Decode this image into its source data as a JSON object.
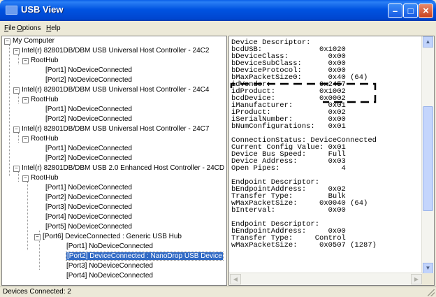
{
  "window": {
    "title": "USB View"
  },
  "menu": {
    "file": "File",
    "options": "Options",
    "help": "Help"
  },
  "tree": {
    "root": "My Computer",
    "c1": "Intel(r) 82801DB/DBM USB Universal Host Controller - 24C2",
    "c1_hub": "RootHub",
    "c1_p1": "[Port1] NoDeviceConnected",
    "c1_p2": "[Port2] NoDeviceConnected",
    "c2": "Intel(r) 82801DB/DBM USB Universal Host Controller - 24C4",
    "c2_hub": "RootHub",
    "c2_p1": "[Port1] NoDeviceConnected",
    "c2_p2": "[Port2] NoDeviceConnected",
    "c3": "Intel(r) 82801DB/DBM USB Universal Host Controller - 24C7",
    "c3_hub": "RootHub",
    "c3_p1": "[Port1] NoDeviceConnected",
    "c3_p2": "[Port2] NoDeviceConnected",
    "c4": "Intel(r) 82801DB/DBM USB 2.0 Enhanced Host Controller - 24CD",
    "c4_hub": "RootHub",
    "c4_p1": "[Port1] NoDeviceConnected",
    "c4_p2": "[Port2] NoDeviceConnected",
    "c4_p3": "[Port3] NoDeviceConnected",
    "c4_p4": "[Port4] NoDeviceConnected",
    "c4_p5": "[Port5] NoDeviceConnected",
    "c4_p6": "[Port6] DeviceConnected : Generic USB Hub",
    "h_p1": "[Port1] NoDeviceConnected",
    "h_p2": "[Port2] DeviceConnected : NanoDrop USB Device",
    "h_p3": "[Port3] NoDeviceConnected",
    "h_p4": "[Port4] NoDeviceConnected"
  },
  "details": {
    "text": "Device Descriptor:\nbcdUSB:             0x1020\nbDeviceClass:         0x00\nbDeviceSubClass:      0x00\nbDeviceProtocol:      0x00\nbMaxPacketSize0:      0x40 (64)\nidVendor:           0x2457\nidProduct:          0x1002\nbcdDevice:          0x0002\niManufacturer:        0x01\niProduct:             0x02\niSerialNumber:        0x00\nbNumConfigurations:   0x01\n\nConnectionStatus: DeviceConnected\nCurrent Config Value: 0x01\nDevice Bus Speed:     Full\nDevice Address:       0x03\nOpen Pipes:              4\n\nEndpoint Descriptor:\nbEndpointAddress:     0x02\nTransfer Type:        Bulk\nwMaxPacketSize:     0x0040 (64)\nbInterval:            0x00\n\nEndpoint Descriptor:\nbEndpointAddress:     0x00\nTransfer Type:     Control\nwMaxPacketSize:     0x0507 (1287)"
  },
  "status": {
    "text": "Devices Connected: 2"
  },
  "colors": {
    "title_blue": "#0053e1",
    "selection": "#316ac5",
    "close_red": "#c8401c"
  },
  "icons": {
    "minimize": "minimize-icon",
    "maximize": "maximize-icon",
    "close": "close-icon"
  }
}
